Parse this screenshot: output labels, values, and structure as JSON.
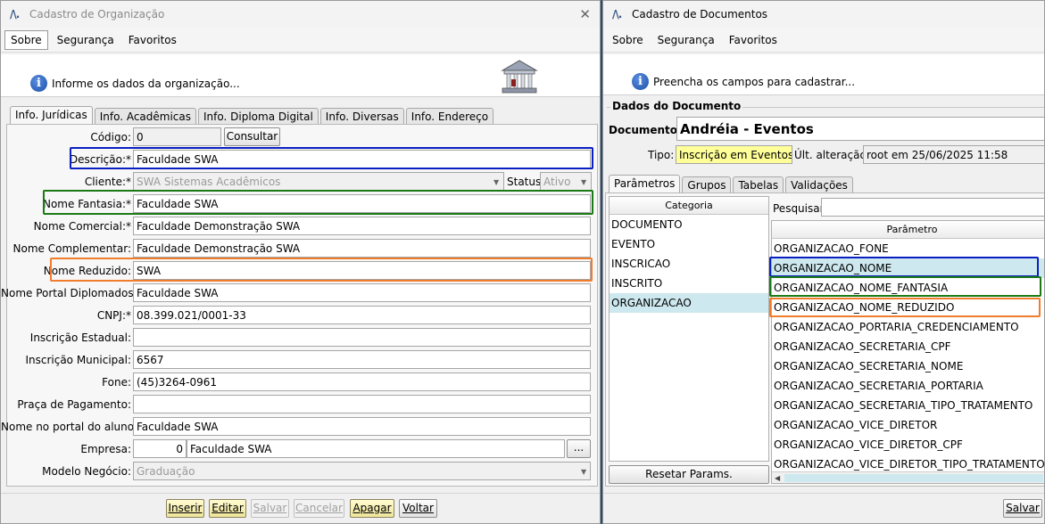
{
  "left": {
    "title": "Cadastro de Organização",
    "menu": [
      "Sobre",
      "Segurança",
      "Favoritos"
    ],
    "banner": "Informe os dados da organização...",
    "tabs": [
      "Info. Jurídicas",
      "Info. Acadêmicas",
      "Info. Diploma Digital",
      "Info. Diversas",
      "Info. Endereço"
    ],
    "fields": {
      "codigo": {
        "label": "Código:",
        "value": "0"
      },
      "consultar": "Consultar",
      "descricao": {
        "label": "Descrição:*",
        "value": "Faculdade SWA"
      },
      "cliente": {
        "label": "Cliente:*",
        "value": "SWA Sistemas Acadêmicos"
      },
      "status": {
        "label": "Status:",
        "value": "Ativo"
      },
      "nome_fantasia": {
        "label": "Nome Fantasia:*",
        "value": "Faculdade SWA"
      },
      "nome_comercial": {
        "label": "Nome Comercial:*",
        "value": "Faculdade Demonstração SWA"
      },
      "nome_complementar": {
        "label": "Nome Complementar:",
        "value": "Faculdade Demonstração SWA"
      },
      "nome_reduzido": {
        "label": "Nome Reduzido:",
        "value": "SWA"
      },
      "nome_portal_diplomados": {
        "label": "Nome Portal Diplomados:",
        "value": "Faculdade SWA"
      },
      "cnpj": {
        "label": "CNPJ:*",
        "value": "08.399.021/0001-33"
      },
      "inscricao_estadual": {
        "label": "Inscrição Estadual:",
        "value": ""
      },
      "inscricao_municipal": {
        "label": "Inscrição Municipal:",
        "value": "6567"
      },
      "fone": {
        "label": "Fone:",
        "value": "(45)3264-0961"
      },
      "praca_pagamento": {
        "label": "Praça de Pagamento:",
        "value": ""
      },
      "nome_portal_aluno": {
        "label": "Nome no portal do aluno:",
        "value": "Faculdade SWA"
      },
      "empresa": {
        "label": "Empresa:",
        "code": "0",
        "value": "Faculdade SWA",
        "more": "..."
      },
      "modelo_negocio": {
        "label": "Modelo Negócio:",
        "value": "Graduação"
      }
    },
    "buttons": {
      "inserir": "Inserir",
      "editar": "Editar",
      "salvar": "Salvar",
      "cancelar": "Cancelar",
      "apagar": "Apagar",
      "voltar": "Voltar"
    }
  },
  "right": {
    "title": "Cadastro de Documentos",
    "menu": [
      "Sobre",
      "Segurança",
      "Favoritos"
    ],
    "banner": "Preencha os campos para cadastrar...",
    "group_title": "Dados do Documento",
    "documento": {
      "label": "Documento:",
      "value": "Andréia - Eventos"
    },
    "tipo": {
      "label": "Tipo:",
      "value": "Inscrição em Eventos"
    },
    "ult_alteracao": {
      "label": "Últ. alteração:",
      "value": "root em 25/06/2025 11:58"
    },
    "tabs": [
      "Parâmetros",
      "Grupos",
      "Tabelas",
      "Validações"
    ],
    "categoria_header": "Categoria",
    "categorias": [
      "DOCUMENTO",
      "EVENTO",
      "INSCRICAO",
      "INSCRITO",
      "ORGANIZACAO"
    ],
    "pesquisar": "Pesquisar:",
    "parametro_header": "Parâmetro",
    "parametros": [
      "ORGANIZACAO_FONE",
      "ORGANIZACAO_NOME",
      "ORGANIZACAO_NOME_FANTASIA",
      "ORGANIZACAO_NOME_REDUZIDO",
      "ORGANIZACAO_PORTARIA_CREDENCIAMENTO",
      "ORGANIZACAO_SECRETARIA_CPF",
      "ORGANIZACAO_SECRETARIA_NOME",
      "ORGANIZACAO_SECRETARIA_PORTARIA",
      "ORGANIZACAO_SECRETARIA_TIPO_TRATAMENTO",
      "ORGANIZACAO_VICE_DIRETOR",
      "ORGANIZACAO_VICE_DIRETOR_CPF",
      "ORGANIZACAO_VICE_DIRETOR_TIPO_TRATAMENTO"
    ],
    "resetar": "Resetar Params.",
    "salvar": "Salvar"
  },
  "colors": {
    "highlight_blue": "#0a1fc2",
    "highlight_green": "#1b7a16",
    "highlight_orange": "#f07c2c",
    "selected_row": "#cde8ee",
    "tipo_bg": "#ffff99"
  }
}
